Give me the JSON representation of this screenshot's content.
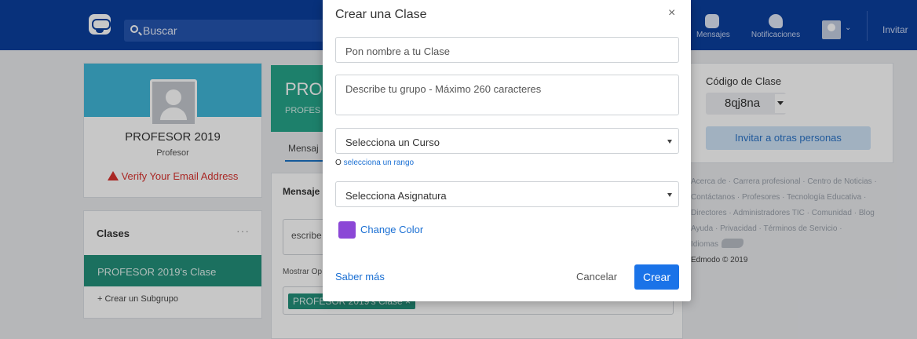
{
  "topbar": {
    "search_placeholder": "Buscar",
    "messages_label": "Mensajes",
    "notifications_label": "Notificaciones",
    "invite_label": "Invitar"
  },
  "profile": {
    "name": "PROFESOR 2019",
    "role": "Profesor",
    "verify_text": "Verify Your Email Address"
  },
  "classes": {
    "title": "Clases",
    "more": "···",
    "active_class": "PROFESOR 2019's Clase",
    "add_subgroup": "+ Crear un Subgrupo"
  },
  "group": {
    "title": "PRO",
    "subtitle": "PROFES",
    "tab_messages": "Mensaj"
  },
  "post": {
    "label": "Mensaje",
    "input_text": "escribe",
    "options_text": "Mostrar Op",
    "recipient_chip": "PROFESOR 2019's Clase ×"
  },
  "class_code": {
    "label": "Código de Clase",
    "value": "8qj8na",
    "invite_button": "Invitar a otras personas"
  },
  "footer": {
    "links": [
      "Acerca de",
      "Carrera profesional",
      "Centro de Noticias",
      "Contáctanos",
      "Profesores",
      "Tecnología Educativa",
      "Directores",
      "Administradores TIC",
      "Comunidad",
      "Blog",
      "Ayuda",
      "Privacidad",
      "Términos de Servicio",
      "Idiomas"
    ],
    "copyright": "Edmodo © 2019"
  },
  "modal": {
    "title": "Crear una Clase",
    "close": "×",
    "name_placeholder": "Pon nombre a tu Clase",
    "description_placeholder": "Describe tu grupo - Máximo 260 caracteres",
    "course_select": "Selecciona un Curso",
    "range_prefix": "O",
    "range_link": "selecciona un rango",
    "subject_select": "Selecciona Asignatura",
    "change_color": "Change Color",
    "learn_more": "Saber más",
    "cancel": "Cancelar",
    "create": "Crear"
  },
  "colors": {
    "navbar": "#0b3f9e",
    "accent_green": "#26a589",
    "class_color": "#8b47d6",
    "primary_button": "#1a73e8"
  }
}
